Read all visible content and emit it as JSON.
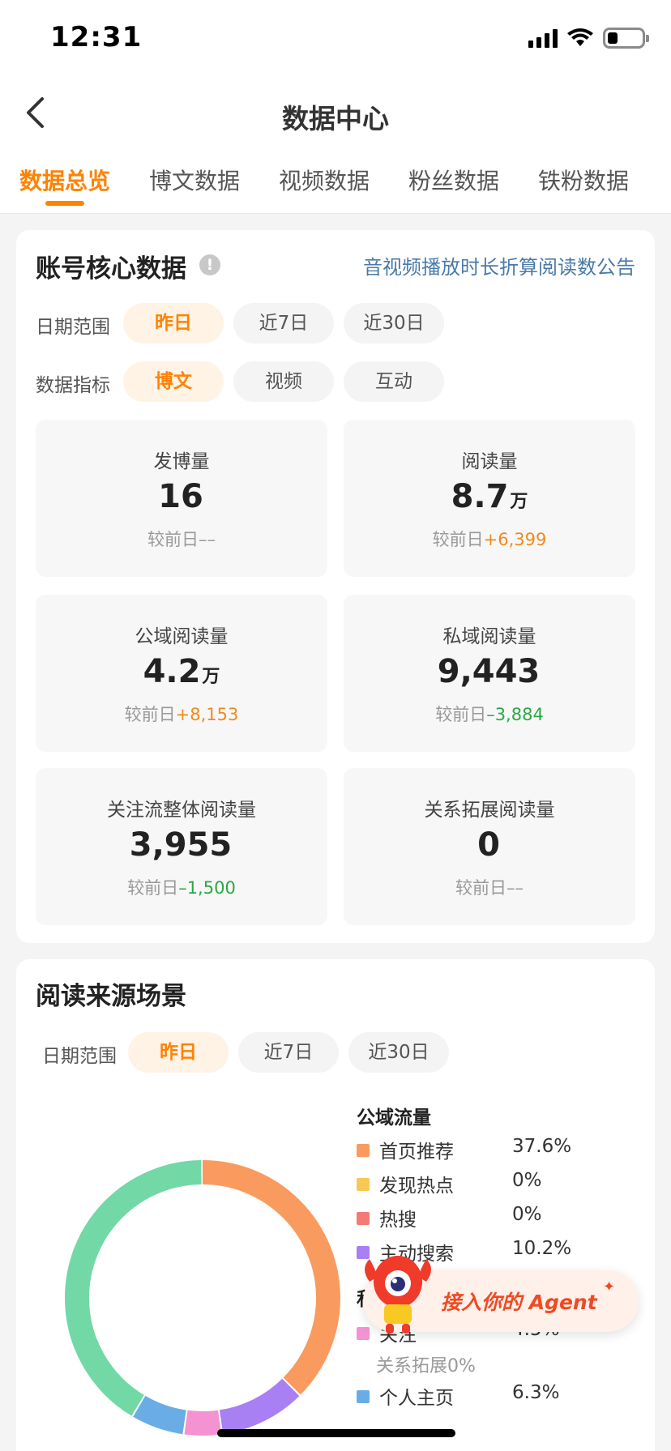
{
  "status_bar": {
    "time": "12:31"
  },
  "nav": {
    "title": "数据中心"
  },
  "tabs": [
    {
      "label": "数据总览",
      "active": true
    },
    {
      "label": "博文数据"
    },
    {
      "label": "视频数据"
    },
    {
      "label": "粉丝数据"
    },
    {
      "label": "铁粉数据"
    }
  ],
  "core": {
    "title": "账号核心数据",
    "info_icon": "!",
    "notice_link": "音视频播放时长折算阅读数公告",
    "date_label": "日期范围",
    "date_options": [
      "昨日",
      "近7日",
      "近30日"
    ],
    "metric_label": "数据指标",
    "metric_options": [
      "博文",
      "视频",
      "互动"
    ],
    "compare_prefix": "较前日",
    "metrics": [
      {
        "label": "发博量",
        "value": "16",
        "unit": "",
        "delta": "––",
        "trend": "none"
      },
      {
        "label": "阅读量",
        "value": "8.7",
        "unit": "万",
        "delta": "+6,399",
        "trend": "up"
      },
      {
        "label": "公域阅读量",
        "value": "4.2",
        "unit": "万",
        "delta": "+8,153",
        "trend": "up"
      },
      {
        "label": "私域阅读量",
        "value": "9,443",
        "unit": "",
        "delta": "–3,884",
        "trend": "down"
      },
      {
        "label": "关注流整体阅读量",
        "value": "3,955",
        "unit": "",
        "delta": "–1,500",
        "trend": "down"
      },
      {
        "label": "关系拓展阅读量",
        "value": "0",
        "unit": "",
        "delta": "––",
        "trend": "none"
      }
    ]
  },
  "source": {
    "title": "阅读来源场景",
    "date_label": "日期范围",
    "date_options": [
      "昨日",
      "近7日",
      "近30日"
    ],
    "public_heading": "公域流量",
    "private_heading": "私",
    "public_items": [
      {
        "name": "首页推荐",
        "pct": "37.6%",
        "color": "#f99b5f"
      },
      {
        "name": "发现热点",
        "pct": "0%",
        "color": "#f8c856"
      },
      {
        "name": "热搜",
        "pct": "0%",
        "color": "#f47a78"
      },
      {
        "name": "主动搜索",
        "pct": "10.2%",
        "color": "#a880f4"
      }
    ],
    "private_items": [
      {
        "name": "关注",
        "pct": "4.5%",
        "color": "#f492d2",
        "sub": "关系拓展0%"
      },
      {
        "name": "个人主页",
        "pct": "6.3%",
        "color": "#6aade6"
      }
    ],
    "donut_rest_color": "#72d8a6"
  },
  "agent_banner": {
    "text": "接入你的 Agent",
    "star": "✦"
  }
}
